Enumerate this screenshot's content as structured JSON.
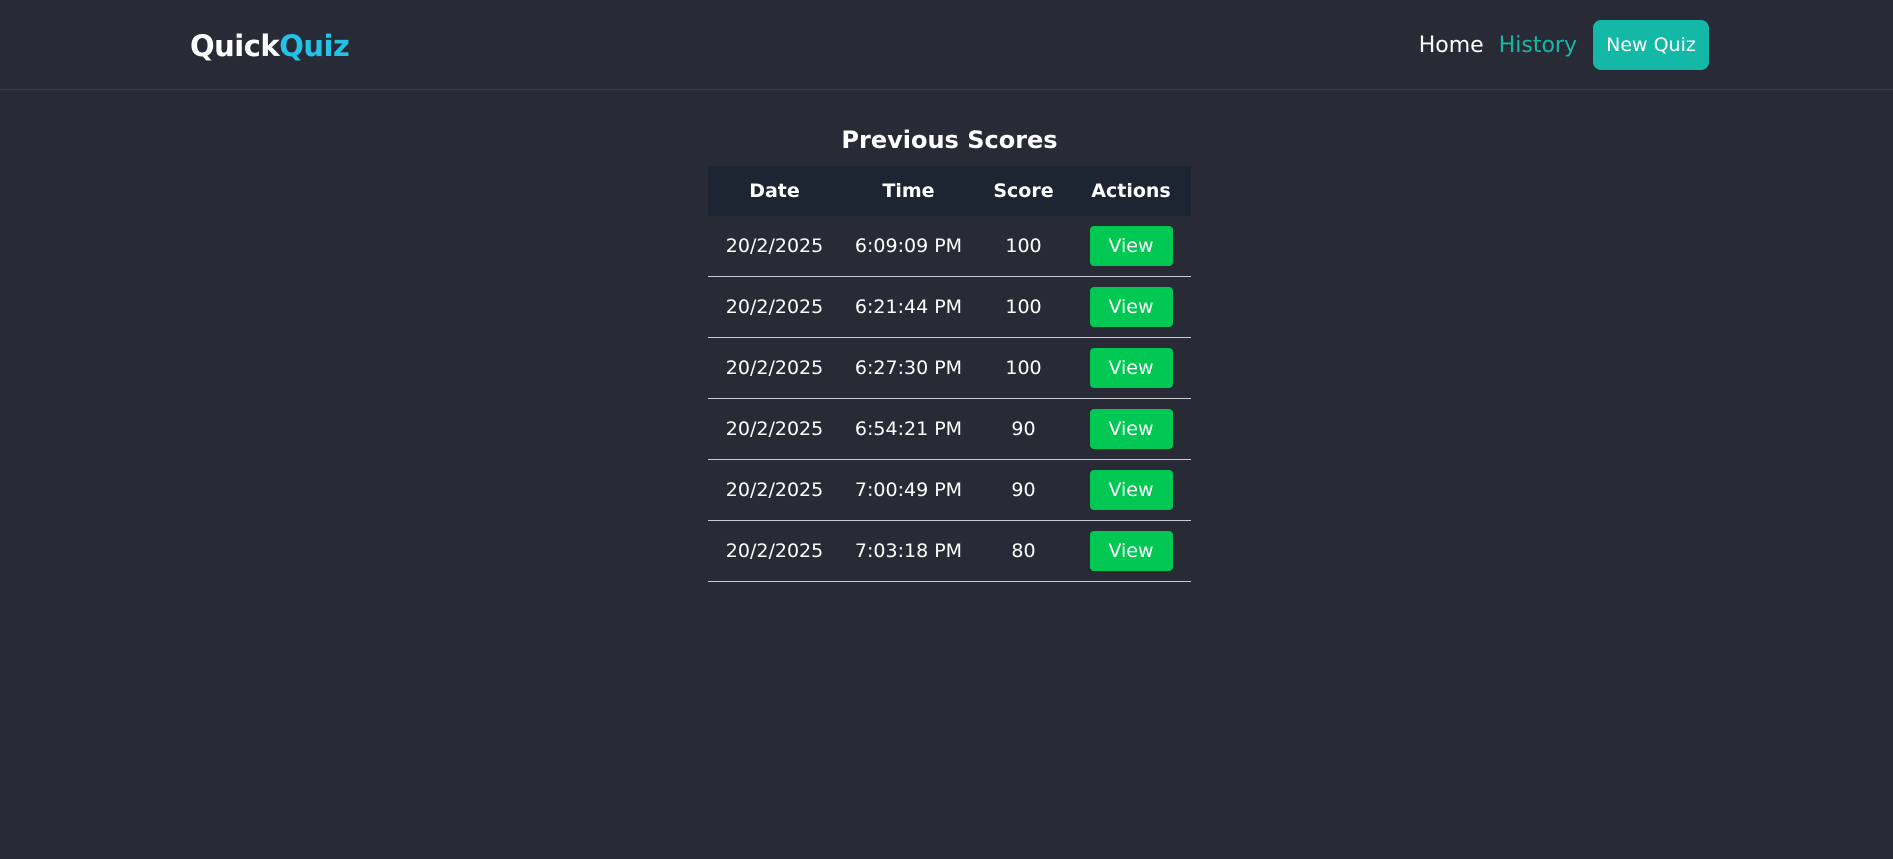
{
  "header": {
    "logo_part1": "Quick",
    "logo_part2": "Quiz",
    "nav": {
      "home": "Home",
      "history": "History",
      "new_quiz": "New Quiz"
    }
  },
  "main": {
    "title": "Previous Scores",
    "columns": [
      "Date",
      "Time",
      "Score",
      "Actions"
    ],
    "rows": [
      {
        "date": "20/2/2025",
        "time": "6:09:09 PM",
        "score": "100",
        "action": "View"
      },
      {
        "date": "20/2/2025",
        "time": "6:21:44 PM",
        "score": "100",
        "action": "View"
      },
      {
        "date": "20/2/2025",
        "time": "6:27:30 PM",
        "score": "100",
        "action": "View"
      },
      {
        "date": "20/2/2025",
        "time": "6:54:21 PM",
        "score": "90",
        "action": "View"
      },
      {
        "date": "20/2/2025",
        "time": "7:00:49 PM",
        "score": "90",
        "action": "View"
      },
      {
        "date": "20/2/2025",
        "time": "7:03:18 PM",
        "score": "80",
        "action": "View"
      }
    ]
  },
  "colors": {
    "background": "#282a36",
    "accent": "#14b8a6",
    "logo_accent": "#22c3e6",
    "view_button": "#00c853",
    "table_header": "#1e2532"
  }
}
